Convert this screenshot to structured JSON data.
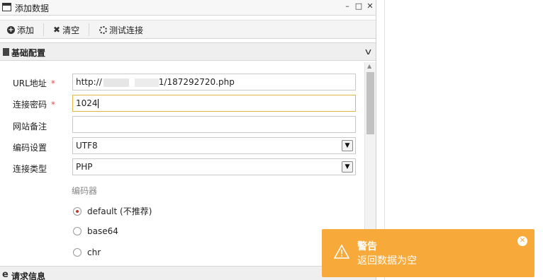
{
  "window": {
    "title": "添加数据",
    "controls": {
      "minimize": "–",
      "maximize": "□",
      "close": "✕"
    }
  },
  "toolbar": {
    "add_label": "添加",
    "clear_label": "清空",
    "test_label": "测试连接"
  },
  "sections": {
    "basic_title": "基础配置",
    "request_title": "请求信息"
  },
  "form": {
    "url_label": "URL地址",
    "url_value_start": "http://",
    "url_value_end": "1/187292720.php",
    "password_label": "连接密码",
    "password_value": "1024",
    "note_label": "网站备注",
    "note_value": "",
    "encoding_label": "编码设置",
    "encoding_value": "UTF8",
    "type_label": "连接类型",
    "type_value": "PHP",
    "required_mark": "*"
  },
  "encoder": {
    "title": "编码器",
    "options": [
      "default (不推荐)",
      "base64",
      "chr"
    ],
    "selected": 0
  },
  "toast": {
    "title": "警告",
    "message": "返回数据为空",
    "color": "#f7a93a"
  }
}
